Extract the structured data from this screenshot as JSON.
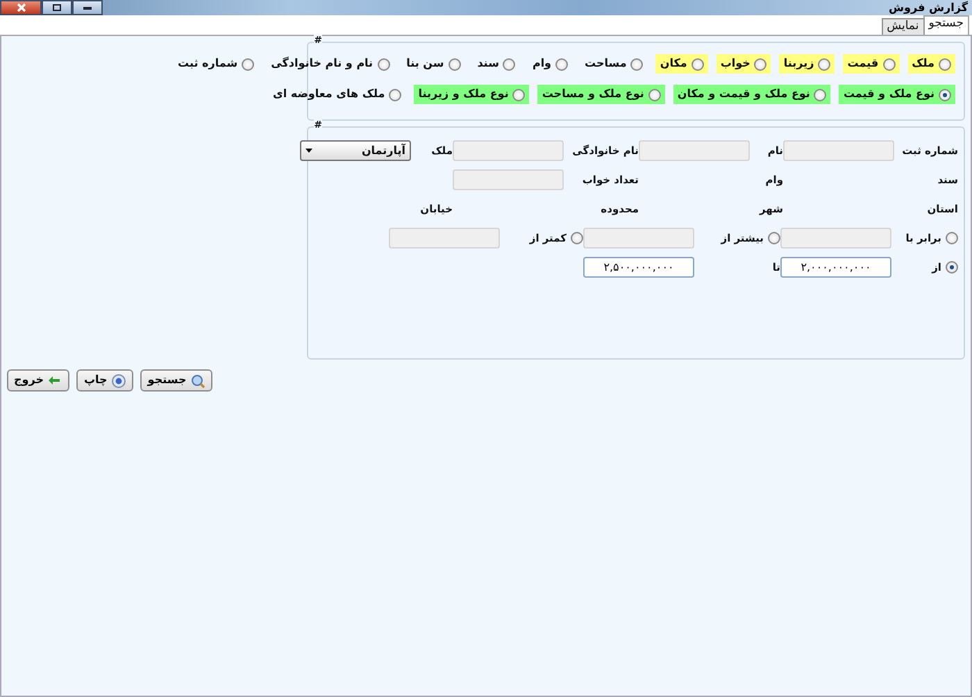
{
  "window": {
    "title": "گزارش فروش"
  },
  "tabs": [
    {
      "label": "جستجو",
      "selected": true
    },
    {
      "label": "نمایش",
      "selected": false
    }
  ],
  "criteria_group": {
    "legend": "#",
    "option_rows": [
      [
        {
          "label": "ملک",
          "selected": false,
          "color": "#ffff80"
        },
        {
          "label": "قیمت",
          "selected": false,
          "color": "#ffff80"
        },
        {
          "label": "زیربنا",
          "selected": false,
          "color": "#ffff80"
        },
        {
          "label": "خواب",
          "selected": false,
          "color": "#ffff80"
        },
        {
          "label": "مکان",
          "selected": false,
          "color": "#ffff80"
        },
        {
          "label": "مساحت",
          "selected": false
        },
        {
          "label": "وام",
          "selected": false
        },
        {
          "label": "سند",
          "selected": false
        },
        {
          "label": "سن بنا",
          "selected": false
        },
        {
          "label": "نام و نام خانوادگی",
          "selected": false
        },
        {
          "label": "شماره ثبت",
          "selected": false
        }
      ],
      [
        {
          "label": "نوع ملک و قیمت",
          "selected": true,
          "color": "#80ff80"
        },
        {
          "label": "نوع ملک و قیمت و مکان",
          "selected": false,
          "color": "#80ff80"
        },
        {
          "label": "نوع ملک و مساحت",
          "selected": false,
          "color": "#80ff80"
        },
        {
          "label": "نوع ملک و زیربنا",
          "selected": false,
          "color": "#80ff80"
        },
        {
          "label": "ملک های معاوضه ای",
          "selected": false
        }
      ]
    ]
  },
  "filter_group": {
    "legend": "#",
    "rows": [
      [
        {
          "label": "شماره ثبت",
          "control": {
            "kind": "field",
            "disabled": true
          }
        },
        {
          "label": "نام",
          "control": {
            "kind": "field",
            "disabled": true
          }
        },
        {
          "label": "نام خانوادگی",
          "control": {
            "kind": "field",
            "disabled": true
          }
        },
        {
          "label": "ملک",
          "control": {
            "kind": "dropdown",
            "value": "آپارتمان"
          }
        }
      ],
      [
        {
          "label": "سند"
        },
        {
          "label": "وام"
        },
        {
          "label": "تعداد خواب",
          "control": {
            "kind": "field",
            "disabled": true
          }
        }
      ],
      [
        {
          "label": "استان"
        },
        {
          "label": "شهر"
        },
        {
          "label": "محدوده"
        },
        {
          "label": "خیابان"
        }
      ]
    ],
    "range_rows": [
      [
        {
          "kind": "radio",
          "label": "برابر با",
          "selected": false,
          "field": {
            "disabled": true
          }
        },
        {
          "kind": "radio",
          "label": "بیشتر از",
          "selected": false,
          "field": {
            "disabled": true
          }
        },
        {
          "kind": "radio",
          "label": "کمتر از",
          "selected": false,
          "field": {
            "disabled": true
          }
        }
      ],
      [
        {
          "kind": "radio",
          "label": "از",
          "selected": true,
          "field": {
            "disabled": false,
            "value": "۲,۰۰۰,۰۰۰,۰۰۰"
          }
        },
        {
          "kind": "label",
          "label": "تا",
          "field": {
            "disabled": false,
            "value": "۲,۵۰۰,۰۰۰,۰۰۰"
          }
        }
      ]
    ]
  },
  "buttons": [
    {
      "label": "جستجو",
      "kind": "search"
    },
    {
      "label": "چاپ",
      "kind": "print"
    },
    {
      "label": "خروج",
      "kind": "exit"
    }
  ]
}
